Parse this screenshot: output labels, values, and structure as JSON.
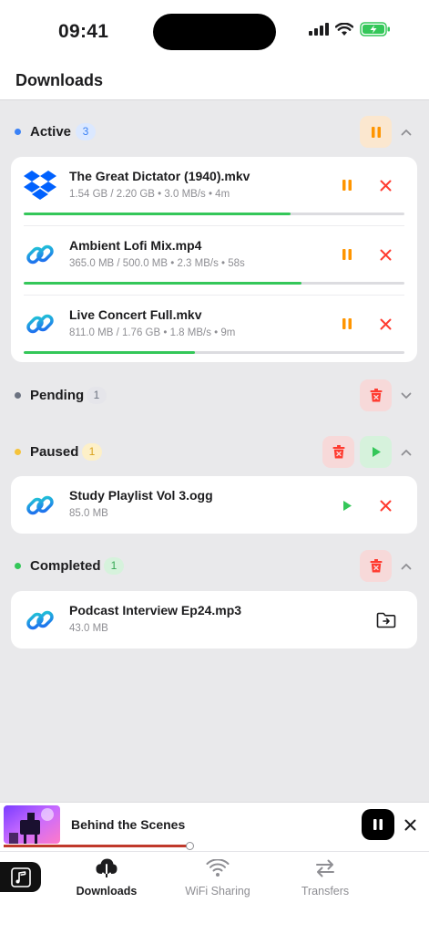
{
  "status_bar": {
    "time": "09:41"
  },
  "nav": {
    "title": "Downloads"
  },
  "colors": {
    "accent_active": "#3b82f6",
    "pending": "#6b7280",
    "paused": "#f5c33b",
    "completed": "#34c759",
    "pause_orange": "#ff9500",
    "cancel_red": "#ff3b30"
  },
  "sections": {
    "active": {
      "title": "Active",
      "count": "3",
      "items": [
        {
          "name": "The Great Dictator (1940).mkv",
          "meta": "1.54 GB / 2.20 GB • 3.0 MB/s • 4m",
          "source_icon": "dropbox-icon",
          "progress": 0.7
        },
        {
          "name": "Ambient Lofi Mix.mp4",
          "meta": "365.0 MB / 500.0 MB • 2.3 MB/s • 58s",
          "source_icon": "link-icon",
          "progress": 0.73
        },
        {
          "name": "Live Concert Full.mkv",
          "meta": "811.0 MB / 1.76 GB • 1.8 MB/s • 9m",
          "source_icon": "link-icon",
          "progress": 0.45
        }
      ]
    },
    "pending": {
      "title": "Pending",
      "count": "1"
    },
    "paused": {
      "title": "Paused",
      "count": "1",
      "items": [
        {
          "name": "Study Playlist Vol 3.ogg",
          "meta": "85.0 MB",
          "source_icon": "link-icon"
        }
      ]
    },
    "completed": {
      "title": "Completed",
      "count": "1",
      "items": [
        {
          "name": "Podcast Interview Ep24.mp3",
          "meta": "43.0 MB",
          "source_icon": "link-icon"
        }
      ]
    }
  },
  "player": {
    "title": "Behind the Scenes",
    "progress": 0.44
  },
  "tabs": [
    {
      "label": "Downloads",
      "icon": "cloud-download-icon",
      "selected": true
    },
    {
      "label": "WiFi Sharing",
      "icon": "wifi-icon",
      "selected": false
    },
    {
      "label": "Transfers",
      "icon": "transfer-arrows-icon",
      "selected": false
    }
  ]
}
